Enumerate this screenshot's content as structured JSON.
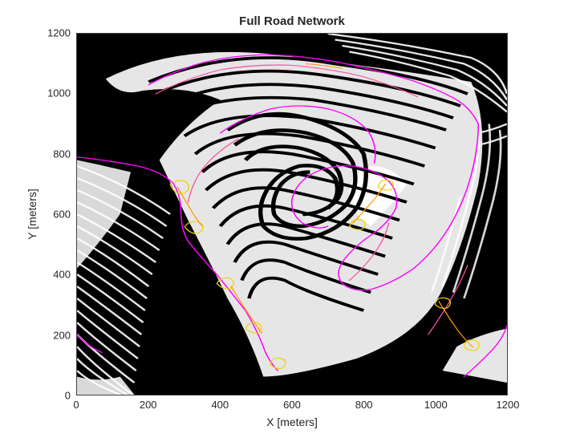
{
  "chart_data": {
    "type": "image",
    "title": "Full Road Network",
    "xlabel": "X [meters]",
    "ylabel": "Y [meters]",
    "xlim": [
      0,
      1200
    ],
    "ylim": [
      0,
      1200
    ],
    "xticks": [
      0,
      200,
      400,
      600,
      800,
      1000,
      1200
    ],
    "yticks": [
      0,
      200,
      400,
      600,
      800,
      1000,
      1200
    ],
    "description": "Dense binary terrain/contour map with curved striations forming a terraced pit shape. Overlaid thin road-network paths in magenta, pink, yellow, and orange tracing switchback routes predominantly through the center, upper, and right regions.",
    "overlay_path_colors": [
      "#ff00ff",
      "#ffb000",
      "#ffe000",
      "#ff60a0"
    ]
  }
}
